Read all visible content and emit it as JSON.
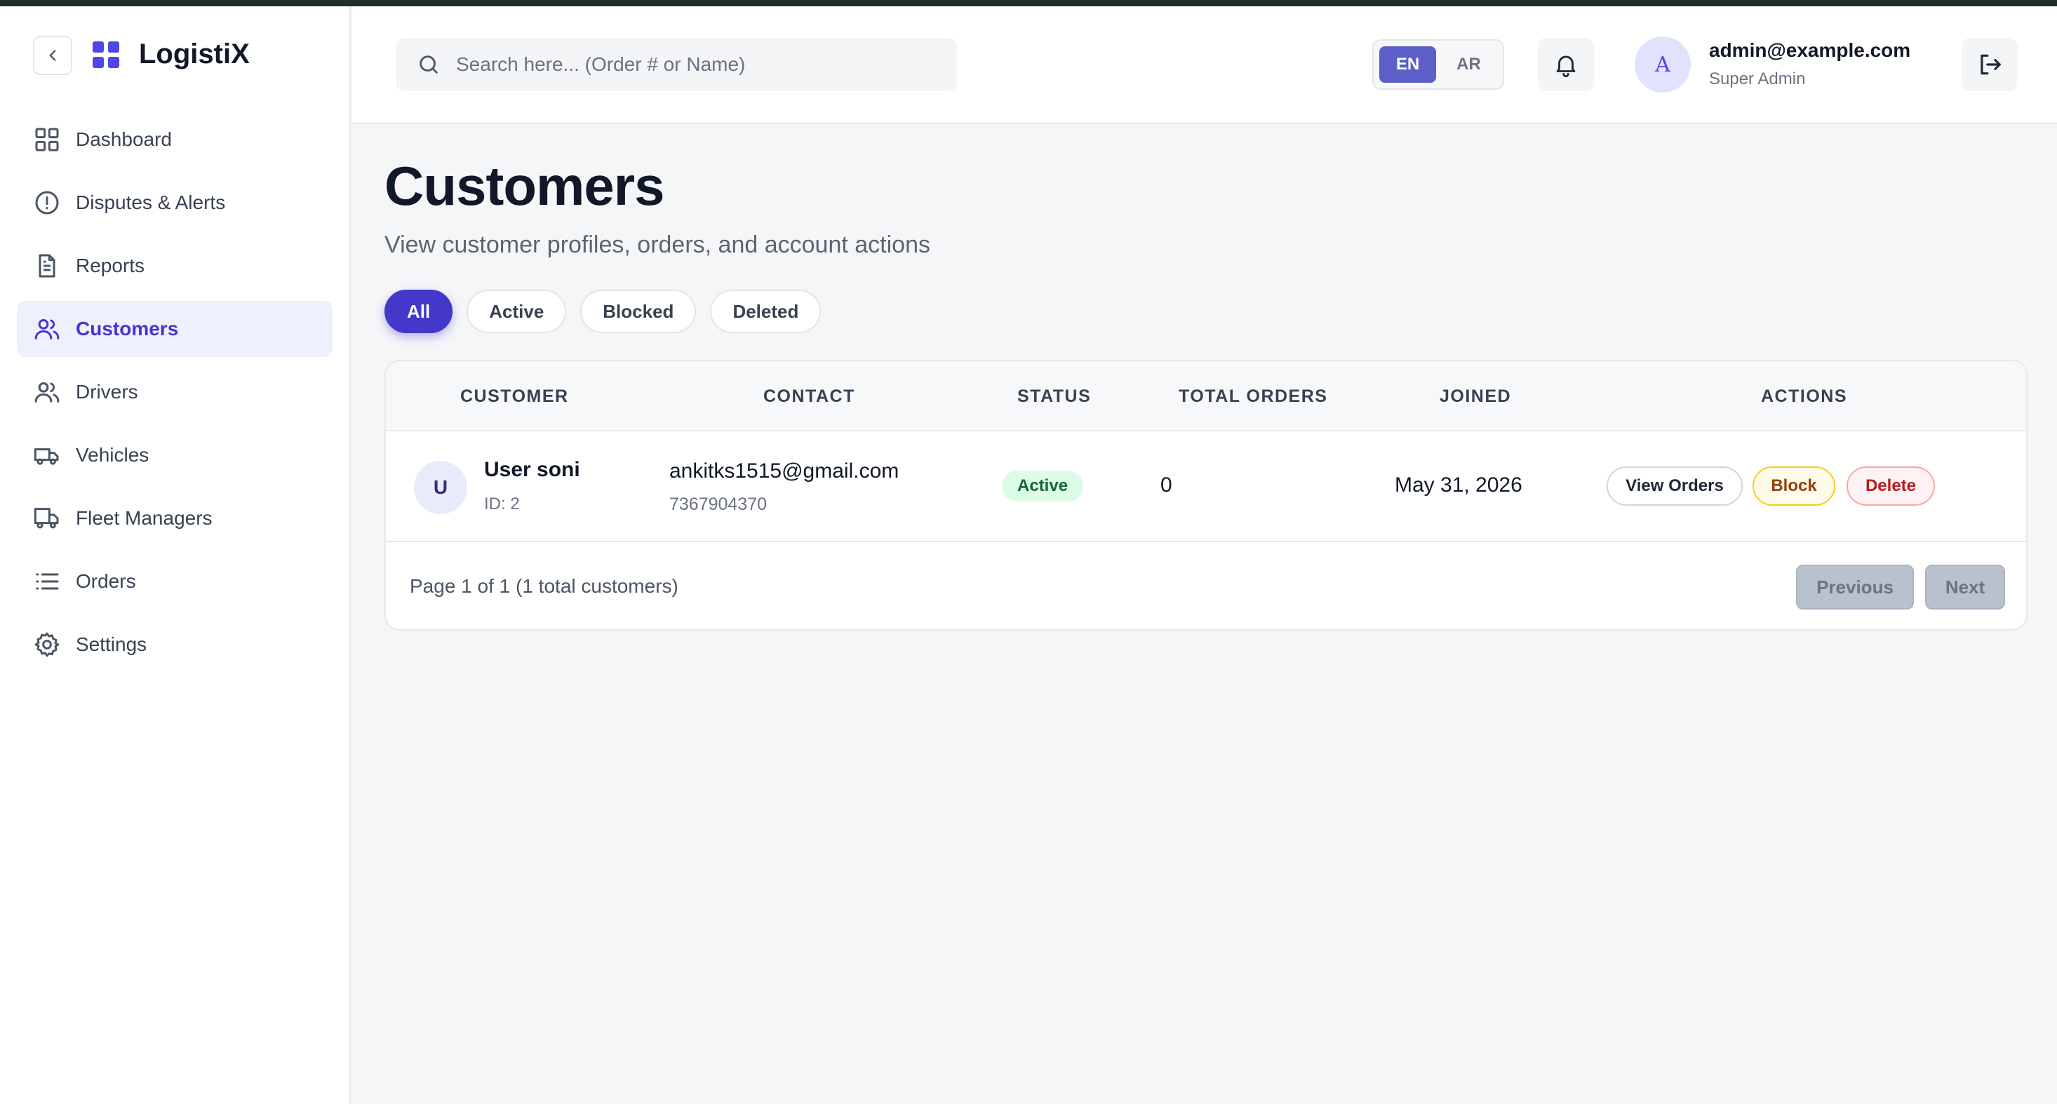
{
  "app": {
    "name": "LogistiX"
  },
  "sidebar": {
    "items": [
      {
        "label": "Dashboard",
        "icon": "grid-icon"
      },
      {
        "label": "Disputes & Alerts",
        "icon": "alert-circle-icon"
      },
      {
        "label": "Reports",
        "icon": "document-icon"
      },
      {
        "label": "Customers",
        "icon": "users-icon",
        "active": true
      },
      {
        "label": "Drivers",
        "icon": "users-icon"
      },
      {
        "label": "Vehicles",
        "icon": "truck-icon"
      },
      {
        "label": "Fleet Managers",
        "icon": "truck-icon"
      },
      {
        "label": "Orders",
        "icon": "list-icon"
      },
      {
        "label": "Settings",
        "icon": "gear-icon"
      }
    ]
  },
  "header": {
    "search_placeholder": "Search here... (Order # or Name)",
    "languages": [
      "EN",
      "AR"
    ],
    "active_language": "EN",
    "user": {
      "avatar_letter": "A",
      "email": "admin@example.com",
      "role": "Super Admin"
    }
  },
  "page": {
    "title": "Customers",
    "subtitle": "View customer profiles, orders, and account actions",
    "filters": [
      "All",
      "Active",
      "Blocked",
      "Deleted"
    ],
    "active_filter": "All"
  },
  "table": {
    "columns": [
      "CUSTOMER",
      "CONTACT",
      "STATUS",
      "TOTAL ORDERS",
      "JOINED",
      "ACTIONS"
    ],
    "rows": [
      {
        "avatar_letter": "U",
        "name": "User soni",
        "id_label": "ID: 2",
        "email": "ankitks1515@gmail.com",
        "phone": "7367904370",
        "status": "Active",
        "total_orders": "0",
        "joined": "May 31, 2026",
        "actions": [
          "View Orders",
          "Block",
          "Delete"
        ]
      }
    ],
    "footer_text": "Page 1 of 1 (1 total customers)",
    "prev_label": "Previous",
    "next_label": "Next"
  },
  "colors": {
    "accent": "#4338ca",
    "active_badge_bg": "#dcfce7",
    "block_border": "#facc15",
    "delete_border": "#fca5a5"
  }
}
